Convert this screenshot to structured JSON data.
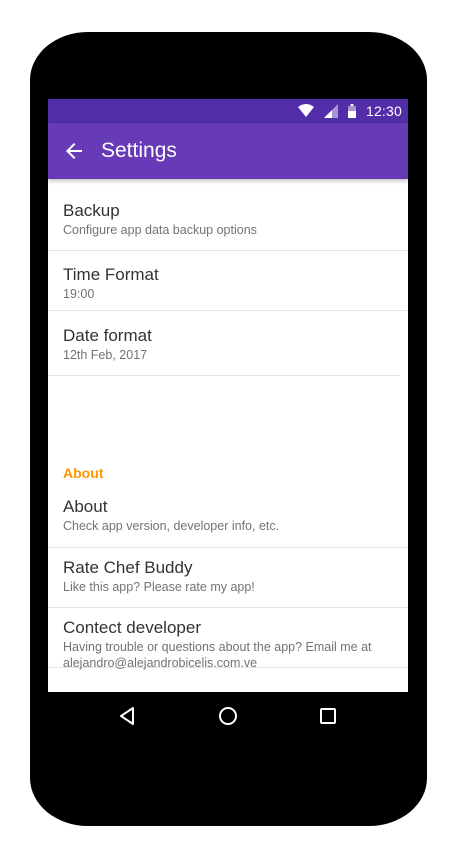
{
  "status_bar": {
    "time": "12:30",
    "icons": [
      "wifi-icon",
      "signal-icon",
      "battery-icon"
    ]
  },
  "app_bar": {
    "title": "Settings",
    "back_icon": "arrow-back-icon"
  },
  "preferences": {
    "general": [
      {
        "title": "Backup",
        "summary": "Configure app data backup options"
      },
      {
        "title": "Time Format",
        "summary": "19:00"
      },
      {
        "title": "Date format",
        "summary": "12th Feb, 2017"
      }
    ],
    "about_category": "About",
    "about": [
      {
        "title": "About",
        "summary": "Check app version, developer info, etc."
      },
      {
        "title": "Rate Chef Buddy",
        "summary": "Like this app? Please rate my app!"
      },
      {
        "title": "Contect developer",
        "summary": "Having trouble or questions about the app? Email me at alejandro@alejandrobicelis.com.ve"
      }
    ]
  },
  "navigation": [
    "back-triangle-icon",
    "home-circle-icon",
    "recents-square-icon"
  ],
  "colors": {
    "status_bar": "#512da8",
    "app_bar": "#673ab7",
    "accent": "#ff9800",
    "device": "#000000"
  }
}
